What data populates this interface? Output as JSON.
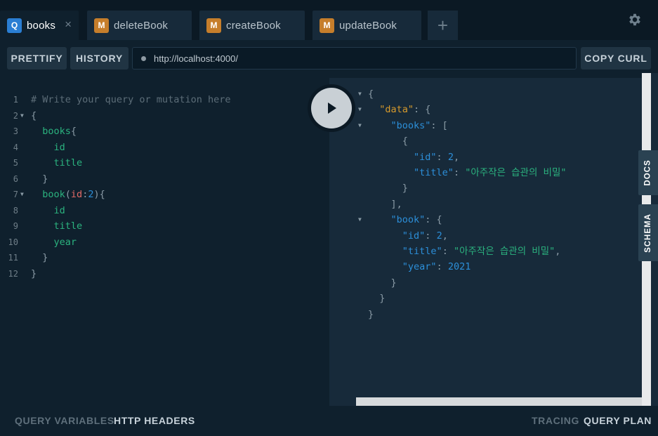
{
  "tabs": [
    {
      "badge": "Q",
      "label": "books",
      "close": "×",
      "active": true
    },
    {
      "badge": "M",
      "label": "deleteBook"
    },
    {
      "badge": "M",
      "label": "createBook"
    },
    {
      "badge": "M",
      "label": "updateBook"
    }
  ],
  "add_tab": "+",
  "toolbar": {
    "prettify": "PRETTIFY",
    "history": "HISTORY",
    "url": "http://localhost:4000/",
    "copy_curl": "COPY CURL"
  },
  "editor_lines": [
    {
      "n": "1",
      "parts": [
        {
          "t": "# Write your query or mutation here",
          "c": "c-comment"
        }
      ]
    },
    {
      "n": "2",
      "fold": true,
      "parts": [
        {
          "t": "{",
          "c": "c-punct"
        }
      ]
    },
    {
      "n": "3",
      "parts": [
        {
          "t": "  books",
          "c": "c-field"
        },
        {
          "t": "{",
          "c": "c-punct"
        }
      ]
    },
    {
      "n": "4",
      "parts": [
        {
          "t": "    id",
          "c": "c-field"
        }
      ]
    },
    {
      "n": "5",
      "parts": [
        {
          "t": "    title",
          "c": "c-field"
        }
      ]
    },
    {
      "n": "6",
      "parts": [
        {
          "t": "  }",
          "c": "c-punct"
        }
      ]
    },
    {
      "n": "7",
      "fold": true,
      "parts": [
        {
          "t": "  book",
          "c": "c-field"
        },
        {
          "t": "(",
          "c": "c-punct"
        },
        {
          "t": "id",
          "c": "c-arg"
        },
        {
          "t": ":",
          "c": "c-punct"
        },
        {
          "t": "2",
          "c": "c-num"
        },
        {
          "t": "){",
          "c": "c-punct"
        }
      ]
    },
    {
      "n": "8",
      "parts": [
        {
          "t": "    id",
          "c": "c-field"
        }
      ]
    },
    {
      "n": "9",
      "parts": [
        {
          "t": "    title",
          "c": "c-field"
        }
      ]
    },
    {
      "n": "10",
      "parts": [
        {
          "t": "    year",
          "c": "c-field"
        }
      ]
    },
    {
      "n": "11",
      "parts": [
        {
          "t": "  }",
          "c": "c-punct"
        }
      ]
    },
    {
      "n": "12",
      "parts": [
        {
          "t": "}",
          "c": "c-punct"
        }
      ]
    }
  ],
  "result_lines": [
    {
      "fold": true,
      "parts": [
        {
          "t": "{",
          "c": "r-punct"
        }
      ]
    },
    {
      "fold": true,
      "parts": [
        {
          "t": "  ",
          "c": "r-punct"
        },
        {
          "t": "\"data\"",
          "c": "r-key-data"
        },
        {
          "t": ": {",
          "c": "r-punct"
        }
      ]
    },
    {
      "fold": true,
      "parts": [
        {
          "t": "    ",
          "c": "r-punct"
        },
        {
          "t": "\"books\"",
          "c": "r-key"
        },
        {
          "t": ": [",
          "c": "r-punct"
        }
      ]
    },
    {
      "parts": [
        {
          "t": "      {",
          "c": "r-punct"
        }
      ]
    },
    {
      "parts": [
        {
          "t": "        ",
          "c": "r-punct"
        },
        {
          "t": "\"id\"",
          "c": "r-key"
        },
        {
          "t": ": ",
          "c": "r-punct"
        },
        {
          "t": "2",
          "c": "r-num"
        },
        {
          "t": ",",
          "c": "r-punct"
        }
      ]
    },
    {
      "parts": [
        {
          "t": "        ",
          "c": "r-punct"
        },
        {
          "t": "\"title\"",
          "c": "r-key"
        },
        {
          "t": ": ",
          "c": "r-punct"
        },
        {
          "t": "\"아주작은 습관의 비밀\"",
          "c": "r-str"
        }
      ]
    },
    {
      "parts": [
        {
          "t": "      }",
          "c": "r-punct"
        }
      ]
    },
    {
      "parts": [
        {
          "t": "    ],",
          "c": "r-punct"
        }
      ]
    },
    {
      "fold": true,
      "parts": [
        {
          "t": "    ",
          "c": "r-punct"
        },
        {
          "t": "\"book\"",
          "c": "r-key"
        },
        {
          "t": ": {",
          "c": "r-punct"
        }
      ]
    },
    {
      "parts": [
        {
          "t": "      ",
          "c": "r-punct"
        },
        {
          "t": "\"id\"",
          "c": "r-key"
        },
        {
          "t": ": ",
          "c": "r-punct"
        },
        {
          "t": "2",
          "c": "r-num"
        },
        {
          "t": ",",
          "c": "r-punct"
        }
      ]
    },
    {
      "parts": [
        {
          "t": "      ",
          "c": "r-punct"
        },
        {
          "t": "\"title\"",
          "c": "r-key"
        },
        {
          "t": ": ",
          "c": "r-punct"
        },
        {
          "t": "\"아주작은 습관의 비밀\"",
          "c": "r-str"
        },
        {
          "t": ",",
          "c": "r-punct"
        }
      ]
    },
    {
      "parts": [
        {
          "t": "      ",
          "c": "r-punct"
        },
        {
          "t": "\"year\"",
          "c": "r-key"
        },
        {
          "t": ": ",
          "c": "r-punct"
        },
        {
          "t": "2021",
          "c": "r-num"
        }
      ]
    },
    {
      "parts": [
        {
          "t": "    }",
          "c": "r-punct"
        }
      ]
    },
    {
      "parts": [
        {
          "t": "  }",
          "c": "r-punct"
        }
      ]
    },
    {
      "parts": [
        {
          "t": "}",
          "c": "r-punct"
        }
      ]
    }
  ],
  "side_tabs": {
    "docs": "DOCS",
    "schema": "SCHEMA"
  },
  "bottom": {
    "query_variables": "QUERY VARIABLES",
    "http_headers": "HTTP HEADERS",
    "tracing": "TRACING",
    "query_plan": "QUERY PLAN"
  },
  "icons": {
    "settings": "gear-icon",
    "play": "play-icon",
    "fold": "fold-arrow-icon"
  },
  "colors": {
    "background": "#0f202d",
    "query_badge": "#2a7ed3",
    "mutation_badge": "#c67e2b",
    "field": "#2bb37f",
    "key": "#2c8fd9",
    "data_key": "#d69a2c",
    "argument": "#e36a66"
  }
}
